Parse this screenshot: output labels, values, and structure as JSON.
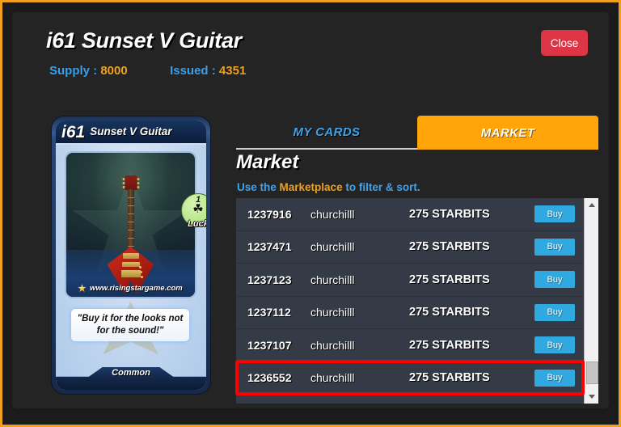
{
  "frame": {
    "border_color": "#f0a01e"
  },
  "header": {
    "title": "i61 Sunset V Guitar",
    "supply_label": "Supply :",
    "supply_value": "8000",
    "issued_label": "Issued :",
    "issued_value": "4351",
    "close_label": "Close"
  },
  "card": {
    "code": "i61",
    "name": "Sunset V Guitar",
    "luck_value": "1",
    "luck_label": "Luck",
    "clover_icon": "☘",
    "watermark": "www.risingstargame.com",
    "quote": "\"Buy it for the looks not for the sound!\"",
    "rarity": "Common"
  },
  "tabs": [
    {
      "label": "MY CARDS",
      "active": false
    },
    {
      "label": "MARKET",
      "active": true
    }
  ],
  "main": {
    "heading": "Market",
    "sub_pre": "Use the ",
    "sub_link": "Marketplace",
    "sub_post": " to filter & sort."
  },
  "market": {
    "buy_label": "Buy",
    "currency": "STARBITS",
    "rows": [
      {
        "id": "1237916",
        "seller": "churchilll",
        "price": "275 STARBITS",
        "highlighted": false
      },
      {
        "id": "1237471",
        "seller": "churchilll",
        "price": "275 STARBITS",
        "highlighted": false
      },
      {
        "id": "1237123",
        "seller": "churchilll",
        "price": "275 STARBITS",
        "highlighted": false
      },
      {
        "id": "1237112",
        "seller": "churchilll",
        "price": "275 STARBITS",
        "highlighted": false
      },
      {
        "id": "1237107",
        "seller": "churchilll",
        "price": "275 STARBITS",
        "highlighted": false
      },
      {
        "id": "1236552",
        "seller": "churchilll",
        "price": "275 STARBITS",
        "highlighted": true
      }
    ]
  },
  "colors": {
    "accent_orange": "#ffa50a",
    "link_blue": "#3fa4ee",
    "buy_blue": "#2fa9e0",
    "close_red": "#dc3545",
    "highlight_red": "#ff0000"
  }
}
